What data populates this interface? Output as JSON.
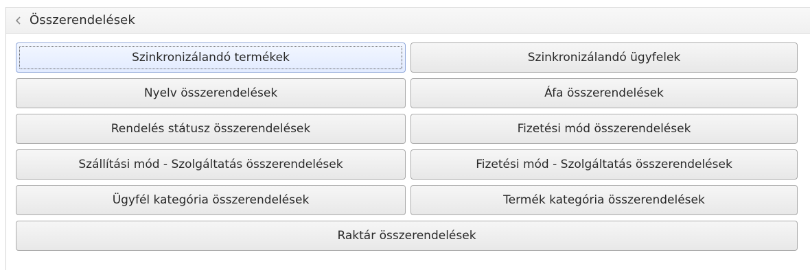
{
  "panel": {
    "title": "Összerendelések",
    "collapse_icon": "chevron-left-icon"
  },
  "buttons": [
    {
      "label": "Szinkronizálandó termékek",
      "focused": true
    },
    {
      "label": "Szinkronizálandó ügyfelek"
    },
    {
      "label": "Nyelv összerendelések"
    },
    {
      "label": "Áfa összerendelések"
    },
    {
      "label": "Rendelés státusz összerendelések"
    },
    {
      "label": "Fizetési mód összerendelések"
    },
    {
      "label": "Szállítási mód - Szolgáltatás összerendelések"
    },
    {
      "label": "Fizetési mód - Szolgáltatás összerendelések"
    },
    {
      "label": "Ügyfél kategória összerendelések"
    },
    {
      "label": "Termék kategória összerendelések"
    },
    {
      "label": "Raktár összerendelések"
    }
  ],
  "colors": {
    "focused_button_bg": "#e2ebff",
    "button_border": "#a9a9a9",
    "header_bg": "#f0f0f0"
  }
}
